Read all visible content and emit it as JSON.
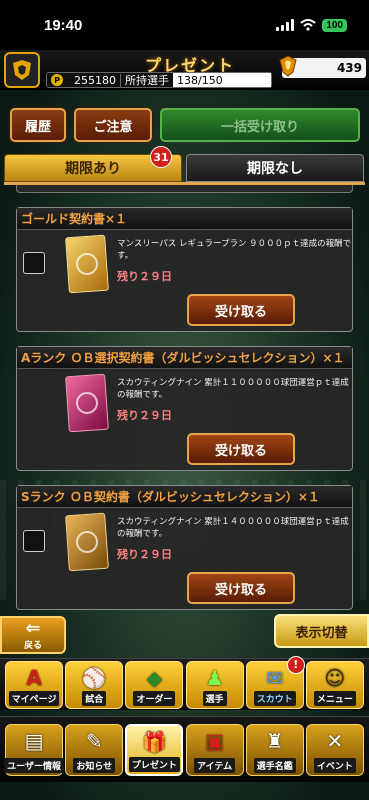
{
  "status_bar": {
    "time": "19:40",
    "battery": "100"
  },
  "header": {
    "title": "プレゼント",
    "points": "255180",
    "players_label": "所持選手",
    "players_count": "138/150",
    "gold": "439"
  },
  "buttons": {
    "history": "履歴",
    "notice": "ご注意",
    "receive_all": "一括受け取り"
  },
  "tabs": {
    "with_deadline": "期限あり",
    "with_deadline_badge": "31",
    "no_deadline": "期限なし"
  },
  "presents": [
    {
      "title": "ゴールド契約書×１",
      "description": "マンスリーパス レギュラープラン ９０００ｐｔ達成の報酬です。",
      "remaining": "残り２９日",
      "button": "受け取る"
    },
    {
      "title": "Aランク ＯＢ選択契約書（ダルビッシュセレクション）×１",
      "description": "スカウティングナイン 累計１１０００００球団運営ｐｔ達成の報酬です。",
      "remaining": "残り２９日",
      "button": "受け取る"
    },
    {
      "title": "Sランク ＯＢ契約書（ダルビッシュセレクション）×１",
      "description": "スカウティングナイン 累計１４０００００球団運営ｐｔ達成の報酬です。",
      "remaining": "残り２９日",
      "button": "受け取る"
    }
  ],
  "bottom": {
    "back": "戻る",
    "toggle": "表示切替"
  },
  "nav_row1": [
    {
      "label": "マイページ",
      "glyph": "A",
      "icon": "mypage-icon"
    },
    {
      "label": "試合",
      "glyph": "⚾",
      "icon": "game-icon"
    },
    {
      "label": "オーダー",
      "glyph": "◆",
      "icon": "order-icon"
    },
    {
      "label": "選手",
      "glyph": "♟",
      "icon": "player-icon"
    },
    {
      "label": "スカウト",
      "glyph": "✉",
      "icon": "scout-icon",
      "badge": "!"
    },
    {
      "label": "メニュー",
      "glyph": "☺",
      "icon": "menu-icon"
    }
  ],
  "nav_row2": [
    {
      "label": "ユーザー情報",
      "glyph": "▤",
      "icon": "user-info-icon"
    },
    {
      "label": "お知らせ",
      "glyph": "✎",
      "icon": "news-icon"
    },
    {
      "label": "プレゼント",
      "glyph": "🎁",
      "icon": "present-icon",
      "active": true
    },
    {
      "label": "アイテム",
      "glyph": "▣",
      "icon": "item-icon"
    },
    {
      "label": "選手名鑑",
      "glyph": "♜",
      "icon": "player-book-icon"
    },
    {
      "label": "イベント",
      "glyph": "✕",
      "icon": "event-icon"
    }
  ],
  "colors": {
    "accent_gold": "#f5c542",
    "title_orange": "#f0a040",
    "remaining_red": "#ff8080",
    "badge_red": "#d0201a"
  }
}
